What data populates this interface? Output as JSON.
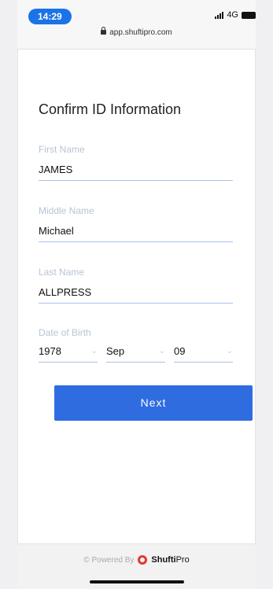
{
  "status_bar": {
    "time": "14:29",
    "network": "4G"
  },
  "url_bar": {
    "url": "app.shuftipro.com"
  },
  "form": {
    "title": "Confirm ID Information",
    "first_name": {
      "label": "First Name",
      "value": "JAMES"
    },
    "middle_name": {
      "label": "Middle Name",
      "value": "Michael"
    },
    "last_name": {
      "label": "Last Name",
      "value": "ALLPRESS"
    },
    "dob": {
      "label": "Date of Birth",
      "year": "1978",
      "month": "Sep",
      "day": "09"
    },
    "next_label": "Next"
  },
  "footer": {
    "powered_by": "Powered By",
    "brand_primary": "Shufti",
    "brand_secondary": "Pro"
  },
  "colors": {
    "accent": "#2f6ce0",
    "time_pill": "#1a73e8",
    "brand_logo": "#e23a2f"
  }
}
